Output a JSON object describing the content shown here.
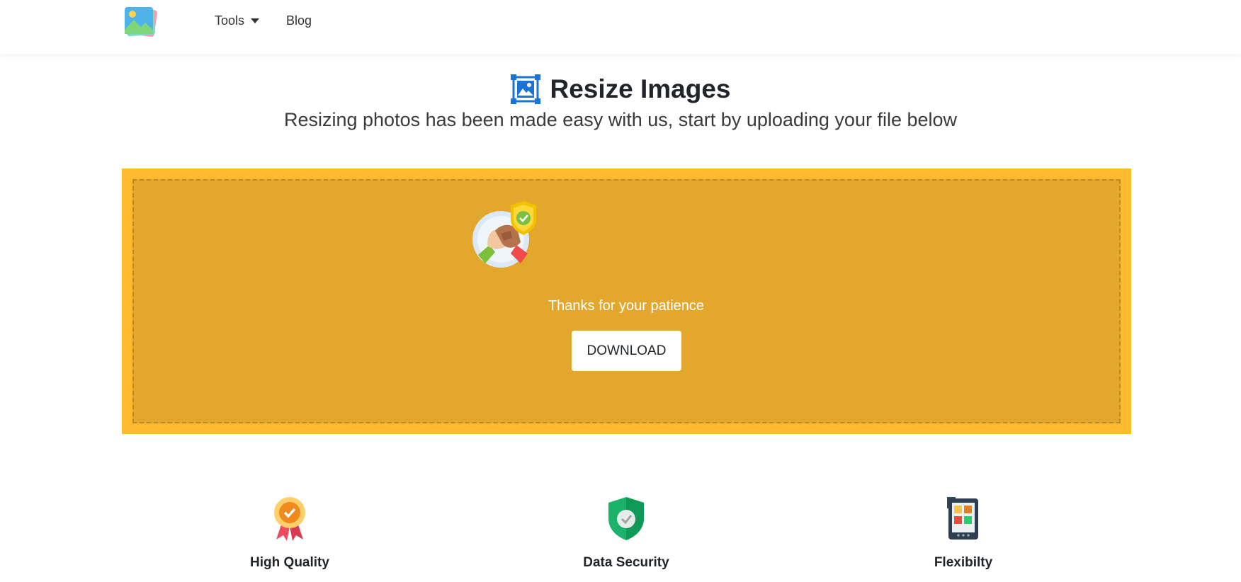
{
  "nav": {
    "tools_label": "Tools",
    "blog_label": "Blog",
    "logo_icon": "photo-stack-logo-icon"
  },
  "header": {
    "title": "Resize Images",
    "subtitle": "Resizing photos has been made easy with us, start by uploading your file below",
    "title_icon": "resize-image-icon"
  },
  "result": {
    "illustration": "handshake-shield-illustration",
    "message": "Thanks for your patience",
    "download_label": "DOWNLOAD"
  },
  "features": [
    {
      "label": "High Quality",
      "icon": "ribbon-badge-icon"
    },
    {
      "label": "Data Security",
      "icon": "shield-check-icon"
    },
    {
      "label": "Flexibilty",
      "icon": "tablet-grid-icon"
    }
  ],
  "colors": {
    "outer_panel": "#ffbb2f",
    "inner_panel": "#e4a72e",
    "accent_blue": "#1a73d9"
  }
}
